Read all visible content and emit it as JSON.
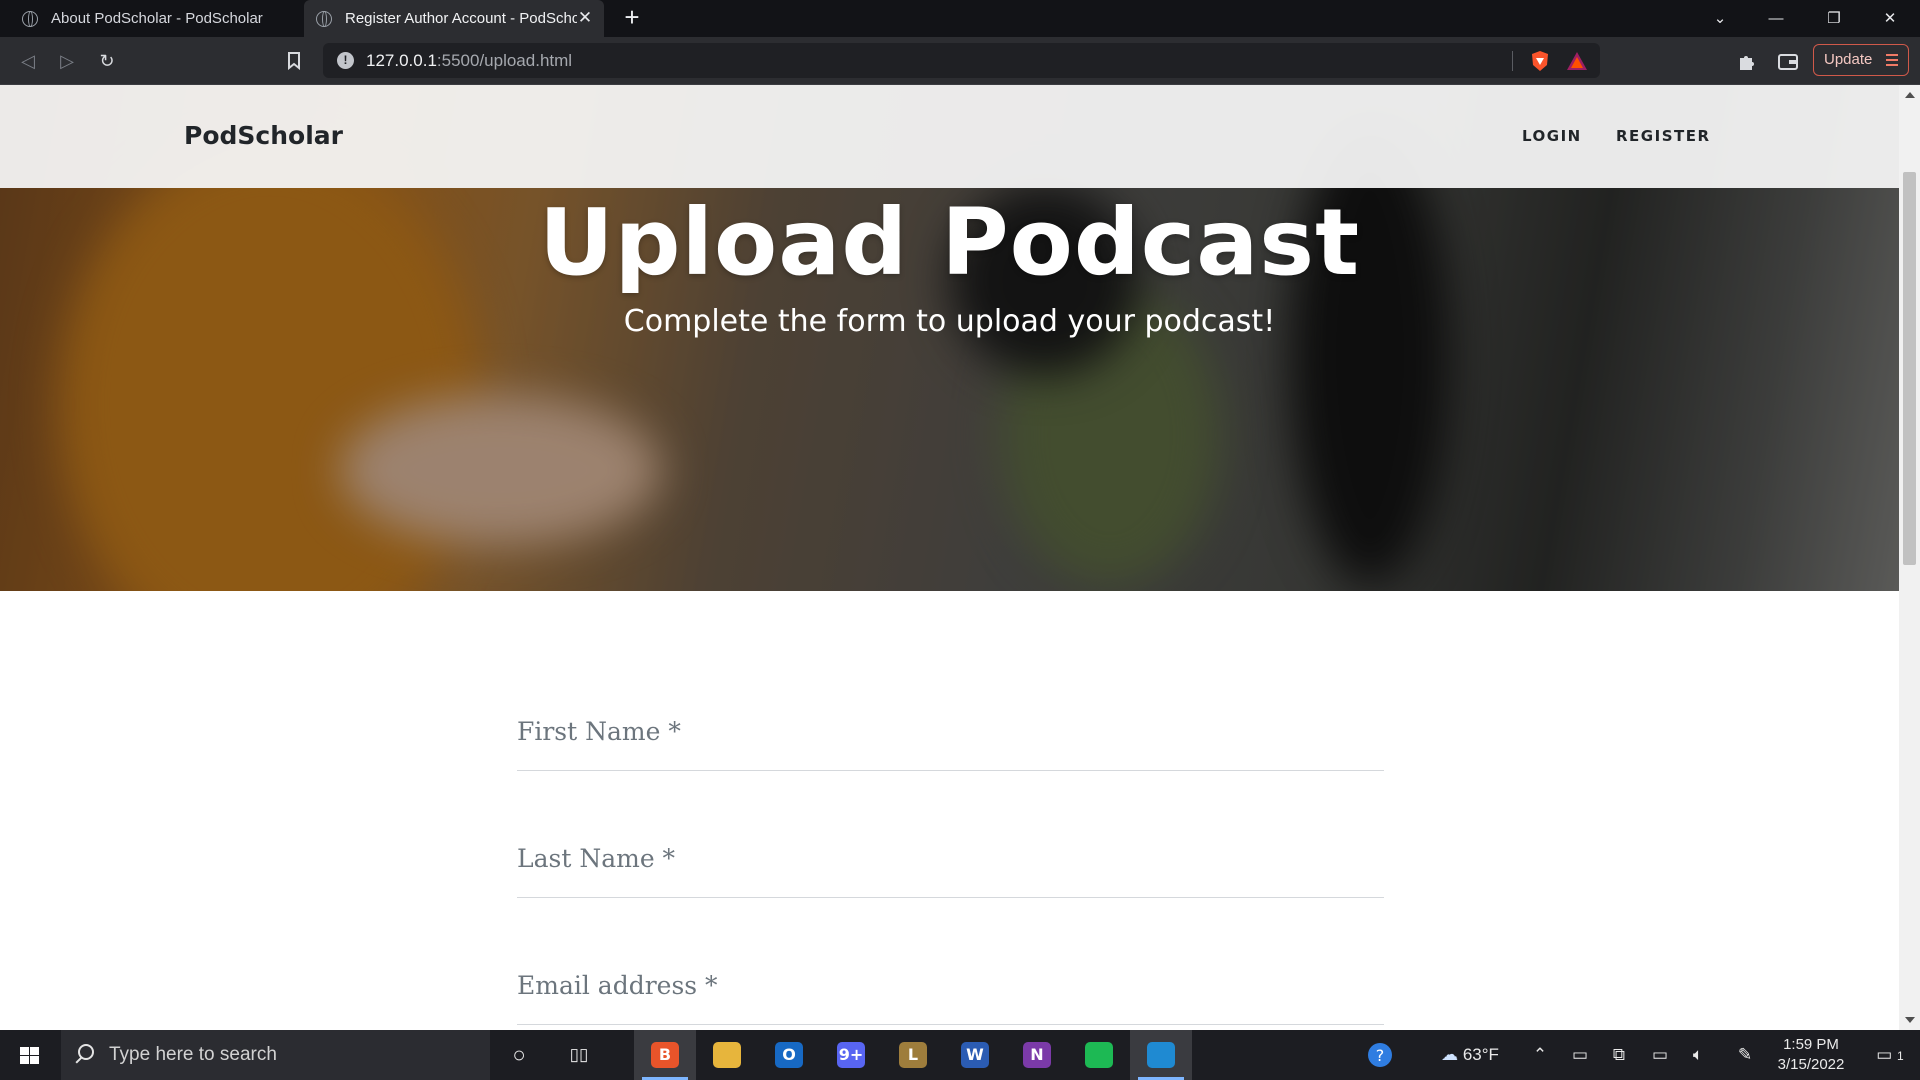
{
  "browser": {
    "tabs": [
      {
        "title": "About PodScholar - PodScholar",
        "active": false
      },
      {
        "title": "Register Author Account - PodScholar",
        "active": true
      }
    ],
    "url_host": "127.0.0.1",
    "url_rest": ":5500/upload.html",
    "update_label": "Update",
    "icons": {
      "back": "back-arrow-icon",
      "forward": "forward-arrow-icon",
      "reload": "reload-icon",
      "bookmark": "bookmark-icon",
      "info": "info-icon",
      "brave_shields": "brave-shields-icon",
      "rewards": "brave-rewards-icon",
      "extensions": "puzzle-icon",
      "wallet": "wallet-icon"
    }
  },
  "site": {
    "brand": "PodScholar",
    "nav": [
      {
        "label": "LOGIN"
      },
      {
        "label": "REGISTER"
      }
    ],
    "hero": {
      "title": "Upload Podcast",
      "subtitle": "Complete the form to upload your podcast!"
    },
    "form": {
      "fields": [
        {
          "placeholder": "First Name *",
          "value": ""
        },
        {
          "placeholder": "Last Name *",
          "value": ""
        },
        {
          "placeholder": "Email address *",
          "value": ""
        }
      ]
    }
  },
  "taskbar": {
    "search_placeholder": "Type here to search",
    "apps": [
      {
        "name": "Brave",
        "color": "#e8542a",
        "glyph": "B"
      },
      {
        "name": "File Explorer",
        "color": "#e7b53c",
        "glyph": ""
      },
      {
        "name": "Outlook",
        "color": "#1769c4",
        "glyph": "O"
      },
      {
        "name": "Discord",
        "color": "#5865f2",
        "glyph": "9+"
      },
      {
        "name": "League of Legends",
        "color": "#9e7d3c",
        "glyph": "L"
      },
      {
        "name": "Word",
        "color": "#2b5cb3",
        "glyph": "W"
      },
      {
        "name": "OneNote",
        "color": "#7b3aa8",
        "glyph": "N"
      },
      {
        "name": "Spotify",
        "color": "#1db954",
        "glyph": ""
      },
      {
        "name": "Visual Studio Code",
        "color": "#1f8ad2",
        "glyph": ""
      }
    ],
    "weather": {
      "temp": "63°F"
    },
    "time": "1:59 PM",
    "date": "3/15/2022",
    "notifications": "1"
  }
}
